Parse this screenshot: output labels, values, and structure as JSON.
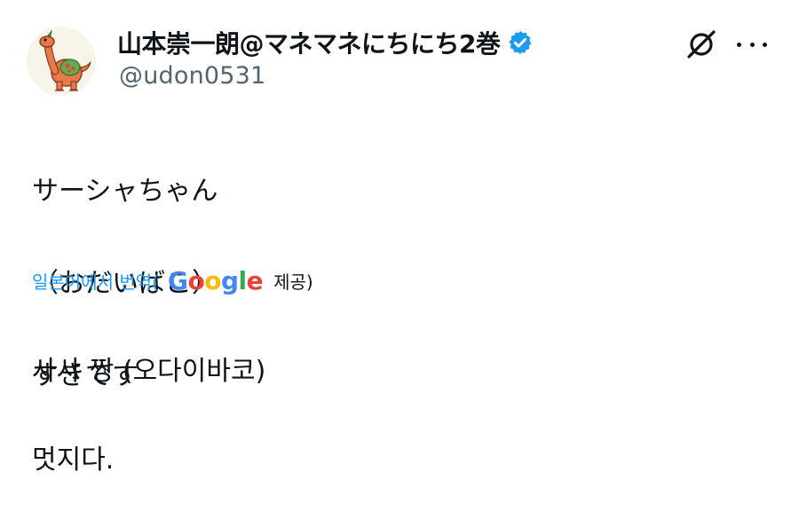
{
  "author": {
    "display_name": "山本崇一朗@マネマネにちにち2巻",
    "handle": "@udon0531",
    "verified": true,
    "avatar_icon": "dinosaur-avatar-icon"
  },
  "header_actions": {
    "grok_icon": "grok-icon",
    "more_icon": "more-options-icon"
  },
  "tweet": {
    "text_lines": [
      "サーシャちゃん",
      "（おだいばこ）",
      "すきです"
    ]
  },
  "translation": {
    "label": "일본어에서 번역(",
    "google_letters": [
      "G",
      "o",
      "o",
      "g",
      "l",
      "e"
    ],
    "provided": "제공)",
    "lines": [
      "사샤 짱 (오다이바코)",
      "멋지다."
    ]
  },
  "colors": {
    "link_blue": "#1d9bf0",
    "handle_gray": "#536471",
    "text": "#0f1419"
  }
}
